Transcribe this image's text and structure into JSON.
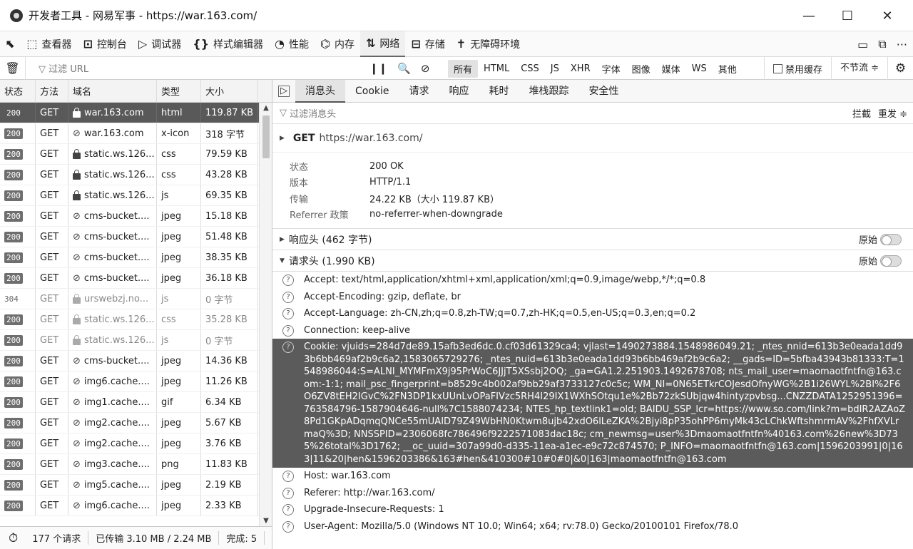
{
  "window": {
    "title": "开发者工具 - 网易军事 - https://war.163.com/",
    "minimize": "—",
    "maximize": "☐",
    "close": "✕"
  },
  "toolbar": {
    "tools": [
      {
        "label": "",
        "icon": "pick-element-icon"
      },
      {
        "label": "查看器",
        "icon": "inspector-icon"
      },
      {
        "label": "控制台",
        "icon": "console-icon"
      },
      {
        "label": "调试器",
        "icon": "debugger-icon"
      },
      {
        "label": "样式编辑器",
        "icon": "style-editor-icon"
      },
      {
        "label": "性能",
        "icon": "performance-icon"
      },
      {
        "label": "内存",
        "icon": "memory-icon"
      },
      {
        "label": "网络",
        "icon": "network-icon"
      },
      {
        "label": "存储",
        "icon": "storage-icon"
      },
      {
        "label": "无障碍环境",
        "icon": "accessibility-icon"
      }
    ],
    "active": "网络"
  },
  "filterbar": {
    "placeholder": "过滤 URL",
    "types": [
      "所有",
      "HTML",
      "CSS",
      "JS",
      "XHR",
      "字体",
      "图像",
      "媒体",
      "WS",
      "其他"
    ],
    "selected_type": "所有",
    "disable_cache": "禁用缓存",
    "throttle": "不节流 ≑"
  },
  "reqlist": {
    "columns": [
      "状态",
      "方法",
      "域名",
      "类型",
      "大小"
    ],
    "rows": [
      {
        "status": "200",
        "method": "GET",
        "domain": "war.163.com",
        "type": "html",
        "size": "119.87 KB",
        "secure": true
      },
      {
        "status": "200",
        "method": "GET",
        "domain": "war.163.com",
        "type": "x-icon",
        "size": "318 字节",
        "secure": false
      },
      {
        "status": "200",
        "method": "GET",
        "domain": "static.ws.126...",
        "type": "css",
        "size": "79.59 KB",
        "secure": true
      },
      {
        "status": "200",
        "method": "GET",
        "domain": "static.ws.126...",
        "type": "css",
        "size": "43.28 KB",
        "secure": true
      },
      {
        "status": "200",
        "method": "GET",
        "domain": "static.ws.126...",
        "type": "js",
        "size": "69.35 KB",
        "secure": true
      },
      {
        "status": "200",
        "method": "GET",
        "domain": "cms-bucket....",
        "type": "jpeg",
        "size": "15.18 KB",
        "secure": false
      },
      {
        "status": "200",
        "method": "GET",
        "domain": "cms-bucket....",
        "type": "jpeg",
        "size": "51.48 KB",
        "secure": false
      },
      {
        "status": "200",
        "method": "GET",
        "domain": "cms-bucket....",
        "type": "jpeg",
        "size": "38.35 KB",
        "secure": false
      },
      {
        "status": "200",
        "method": "GET",
        "domain": "cms-bucket....",
        "type": "jpeg",
        "size": "36.18 KB",
        "secure": false
      },
      {
        "status": "304",
        "method": "GET",
        "domain": "urswebzj.no...",
        "type": "js",
        "size": "0 字节",
        "secure": true
      },
      {
        "status": "200",
        "method": "GET",
        "domain": "static.ws.126...",
        "type": "css",
        "size": "35.28 KB",
        "secure": true
      },
      {
        "status": "200",
        "method": "GET",
        "domain": "static.ws.126...",
        "type": "js",
        "size": "0 字节",
        "secure": true
      },
      {
        "status": "200",
        "method": "GET",
        "domain": "cms-bucket....",
        "type": "jpeg",
        "size": "14.36 KB",
        "secure": false
      },
      {
        "status": "200",
        "method": "GET",
        "domain": "img6.cache....",
        "type": "jpeg",
        "size": "11.26 KB",
        "secure": false
      },
      {
        "status": "200",
        "method": "GET",
        "domain": "img1.cache....",
        "type": "gif",
        "size": "6.34 KB",
        "secure": false
      },
      {
        "status": "200",
        "method": "GET",
        "domain": "img2.cache....",
        "type": "jpeg",
        "size": "5.67 KB",
        "secure": false
      },
      {
        "status": "200",
        "method": "GET",
        "domain": "img2.cache....",
        "type": "jpeg",
        "size": "3.76 KB",
        "secure": false
      },
      {
        "status": "200",
        "method": "GET",
        "domain": "img3.cache....",
        "type": "png",
        "size": "11.83 KB",
        "secure": false
      },
      {
        "status": "200",
        "method": "GET",
        "domain": "img5.cache....",
        "type": "jpeg",
        "size": "2.19 KB",
        "secure": false
      },
      {
        "status": "200",
        "method": "GET",
        "domain": "img6.cache....",
        "type": "jpeg",
        "size": "2.33 KB",
        "secure": false
      }
    ]
  },
  "statusbar": {
    "requests": "177 个请求",
    "transferred": "已传输 3.10 MB / 2.24 MB",
    "finish": "完成: 5"
  },
  "details": {
    "tabs": [
      "消息头",
      "Cookie",
      "请求",
      "响应",
      "耗时",
      "堆栈跟踪",
      "安全性"
    ],
    "active_tab": "消息头",
    "filter_placeholder": "过滤消息头",
    "block": "拦截",
    "resend": "重发 ≑",
    "summary": {
      "method": "GET",
      "url": "https://war.163.com/"
    },
    "meta": [
      {
        "k": "状态",
        "v": "200 OK"
      },
      {
        "k": "版本",
        "v": "HTTP/1.1"
      },
      {
        "k": "传输",
        "v": "24.22 KB（大小 119.87 KB）"
      },
      {
        "k": "Referrer 政策",
        "v": "no-referrer-when-downgrade"
      }
    ],
    "response_headers": "响应头 (462 字节)",
    "request_headers": "请求头 (1.990 KB)",
    "raw": "原始",
    "headers": [
      {
        "text": "Accept:  text/html,application/xhtml+xml,application/xml;q=0.9,image/webp,*/*;q=0.8",
        "hl": false
      },
      {
        "text": "Accept-Encoding:  gzip, deflate, br",
        "hl": false
      },
      {
        "text": "Accept-Language:  zh-CN,zh;q=0.8,zh-TW;q=0.7,zh-HK;q=0.5,en-US;q=0.3,en;q=0.2",
        "hl": false
      },
      {
        "text": "Connection:  keep-alive",
        "hl": false
      },
      {
        "text": "Cookie:  vjuids=284d7de89.15afb3ed6dc.0.cf03d61329ca4; vjlast=1490273884.1548986049.21; _ntes_nnid=613b3e0eada1dd93b6bb469af2b9c6a2,1583065729276; _ntes_nuid=613b3e0eada1dd93b6bb469af2b9c6a2; __gads=ID=5bfba43943b81333:T=1548986044:S=ALNI_MYMFmX9j95PrWoC6JJjT5XSsbj2OQ; _ga=GA1.2.251903.1492678708; nts_mail_user=maomaotfntfn@163.com:-1:1; mail_psc_fingerprint=b8529c4b002af9bb29af3733127c0c5c; WM_NI=0N65ETkrCOJesdOfnyWG%2B1i26WYL%2BI%2F6O6ZV8tEH2IGvC%2FN3DP1kxUUnLvOPaFIVzc5RH4I29IX1WXhSOtqu1e%2Bb72zkSUbjqw4hintyzpvbsg...CNZZDATA1252951396=763584796-1587904646-null%7C1588074234; NTES_hp_textlink1=old; BAIDU_SSP_lcr=https://www.so.com/link?m=bdIR2AZAoZ8Pd1GKpADqmqQNCe55mUAID79Z49WbHN0Ktwm8ujb42xdO6lLeZKA%2Bjyi8pP35ohPP6myMk43cLChkWftshmrmAV%2FhfXVLrmaQ%3D; NNSSPID=2306068fc786496f9222571083dac18c; cm_newmsg=user%3Dmaomaotfntfn%40163.com%26new%3D735%26total%3D1762; __oc_uuid=307a99d0-d335-11ea-a1ec-e9c72c874570; P_INFO=maomaotfntfn@163.com|1596203991|0|163|11&20|hen&1596203386&163#hen&410300#10#0#0|&0|163|maomaotfntfn@163.com",
        "hl": true
      },
      {
        "text": "Host:  war.163.com",
        "hl": false
      },
      {
        "text": "Referer:  http://war.163.com/",
        "hl": false
      },
      {
        "text": "Upgrade-Insecure-Requests:  1",
        "hl": false
      },
      {
        "text": "User-Agent:  Mozilla/5.0 (Windows NT 10.0; Win64; x64; rv:78.0) Gecko/20100101 Firefox/78.0",
        "hl": false
      }
    ]
  }
}
